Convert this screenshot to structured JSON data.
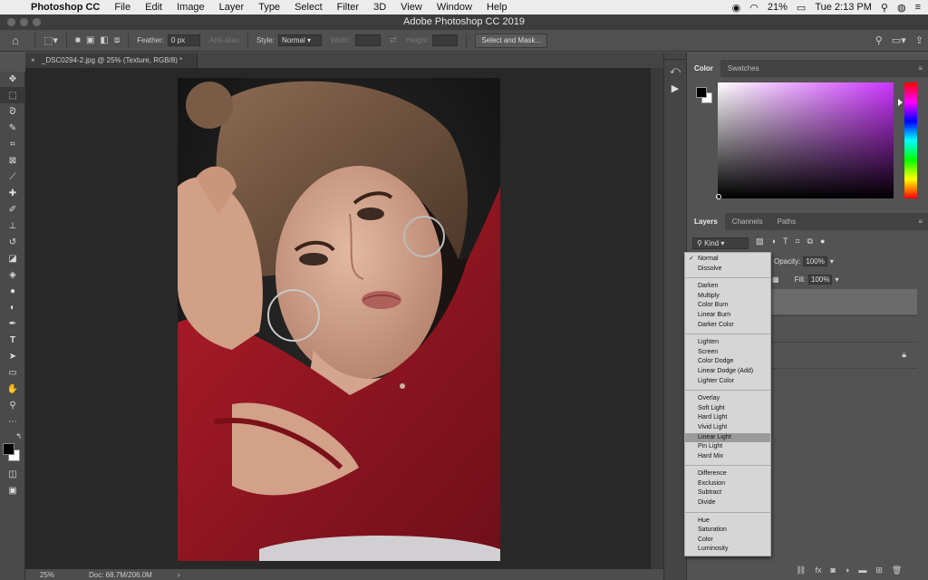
{
  "menubar": {
    "app_name": "Photoshop CC",
    "items": [
      "File",
      "Edit",
      "Image",
      "Layer",
      "Type",
      "Select",
      "Filter",
      "3D",
      "View",
      "Window",
      "Help"
    ],
    "battery": "21%",
    "clock": "Tue 2:13 PM"
  },
  "window": {
    "title": "Adobe Photoshop CC 2019"
  },
  "options": {
    "feather_label": "Feather:",
    "feather_value": "0 px",
    "anti_alias": "Anti-alias",
    "style_label": "Style:",
    "style_value": "Normal",
    "width_label": "Width:",
    "height_label": "Height:",
    "select_mask_button": "Select and Mask..."
  },
  "document": {
    "tab_title": "_DSC0294-2.jpg @ 25% (Texture, RGB/8) *",
    "zoom": "25%",
    "doc_info": "Doc: 68.7M/206.0M"
  },
  "color_panel": {
    "tabs": [
      "Color",
      "Swatches"
    ]
  },
  "layers_panel": {
    "tabs": [
      "Layers",
      "Channels",
      "Paths"
    ],
    "filter_kind": "Kind",
    "opacity_label": "Opacity:",
    "opacity_value": "100%",
    "fill_label": "Fill:",
    "fill_value": "100%"
  },
  "blend_modes": {
    "selected": "Normal",
    "highlighted": "Linear Light",
    "groups": [
      [
        "Normal",
        "Dissolve"
      ],
      [
        "Darken",
        "Multiply",
        "Color Burn",
        "Linear Burn",
        "Darker Color"
      ],
      [
        "Lighten",
        "Screen",
        "Color Dodge",
        "Linear Dodge (Add)",
        "Lighter Color"
      ],
      [
        "Overlay",
        "Soft Light",
        "Hard Light",
        "Vivid Light",
        "Linear Light",
        "Pin Light",
        "Hard Mix"
      ],
      [
        "Difference",
        "Exclusion",
        "Subtract",
        "Divide"
      ],
      [
        "Hue",
        "Saturation",
        "Color",
        "Luminosity"
      ]
    ]
  },
  "colors": {
    "foreground": "#000000",
    "background": "#ffffff",
    "hue_selected": "#cc33ff"
  }
}
